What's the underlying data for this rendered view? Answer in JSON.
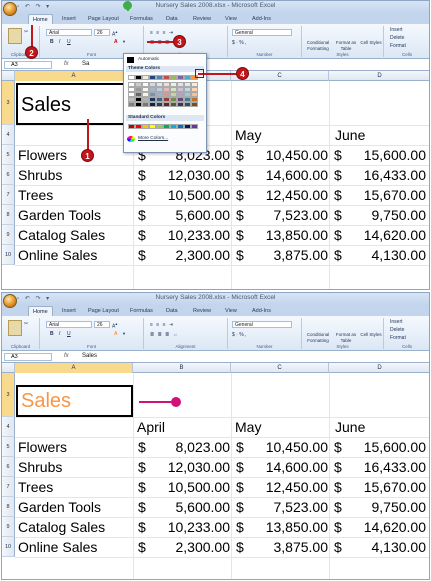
{
  "screens": [
    {
      "window_title": "Nursery Sales 2008.xlsx - Microsoft Excel",
      "tabs": [
        "Home",
        "Insert",
        "Page Layout",
        "Formulas",
        "Data",
        "Review",
        "View",
        "Add-Ins"
      ],
      "font_name": "Arial",
      "font_size": "26",
      "number_format": "General",
      "name_box": "A3",
      "formula_symbol": "fx",
      "formula_value": "Sa",
      "group_labels": [
        "Clipboard",
        "Font",
        "Alignment",
        "Number",
        "Styles",
        "Cells"
      ],
      "styles_buttons": [
        "Conditional Formatting",
        "Format as Table",
        "Cell Styles"
      ],
      "cells_buttons": [
        "Insert",
        "Delete",
        "Format"
      ]
    },
    {
      "window_title": "Nursery Sales 2008.xlsx - Microsoft Excel",
      "tabs": [
        "Home",
        "Insert",
        "Page Layout",
        "Formulas",
        "Data",
        "Review",
        "View",
        "Add-Ins"
      ],
      "font_name": "Arial",
      "font_size": "26",
      "number_format": "General",
      "name_box": "A3",
      "formula_symbol": "fx",
      "formula_value": "Sales",
      "group_labels": [
        "Clipboard",
        "Font",
        "Alignment",
        "Number",
        "Styles",
        "Cells"
      ],
      "styles_buttons": [
        "Conditional Formatting",
        "Format as Table",
        "Cell Styles"
      ],
      "cells_buttons": [
        "Insert",
        "Delete",
        "Format"
      ]
    }
  ],
  "columns": [
    "A",
    "B",
    "C",
    "D"
  ],
  "row_numbers": [
    "3",
    "4",
    "5",
    "6",
    "7",
    "8",
    "9",
    "10"
  ],
  "sheet": {
    "title": "Sales",
    "headers": [
      "April",
      "May",
      "June"
    ],
    "rows": [
      {
        "label": "Flowers",
        "april": "8,023.00",
        "may": "10,450.00",
        "june": "15,600.00"
      },
      {
        "label": "Shrubs",
        "april": "12,030.00",
        "may": "14,600.00",
        "june": "16,433.00"
      },
      {
        "label": "Trees",
        "april": "10,500.00",
        "may": "12,450.00",
        "june": "15,670.00"
      },
      {
        "label": "Garden Tools",
        "april": "5,600.00",
        "may": "7,523.00",
        "june": "9,750.00"
      },
      {
        "label": "Catalog Sales",
        "april": "10,233.00",
        "may": "13,850.00",
        "june": "14,620.00"
      },
      {
        "label": "Online Sales",
        "april": "2,300.00",
        "may": "3,875.00",
        "june": "4,130.00"
      }
    ],
    "currency": "$"
  },
  "color_menu": {
    "automatic": "Automatic",
    "theme_colors_label": "Theme Colors",
    "standard_colors_label": "Standard Colors",
    "more_colors": "More Colors...",
    "theme_top": [
      "#ffffff",
      "#000000",
      "#eeece1",
      "#1f497d",
      "#4f81bd",
      "#c0504d",
      "#9bbb59",
      "#8064a2",
      "#4bacc6",
      "#f79646"
    ],
    "standard": [
      "#c00000",
      "#ff0000",
      "#ffc000",
      "#ffff00",
      "#92d050",
      "#00b050",
      "#00b0f0",
      "#0070c0",
      "#002060",
      "#7030a0"
    ]
  },
  "step_badges": [
    "1",
    "2",
    "3",
    "4"
  ],
  "applied_color": "#f79646",
  "accent_red": "#c3161b",
  "accent_magenta": "#d2107a"
}
